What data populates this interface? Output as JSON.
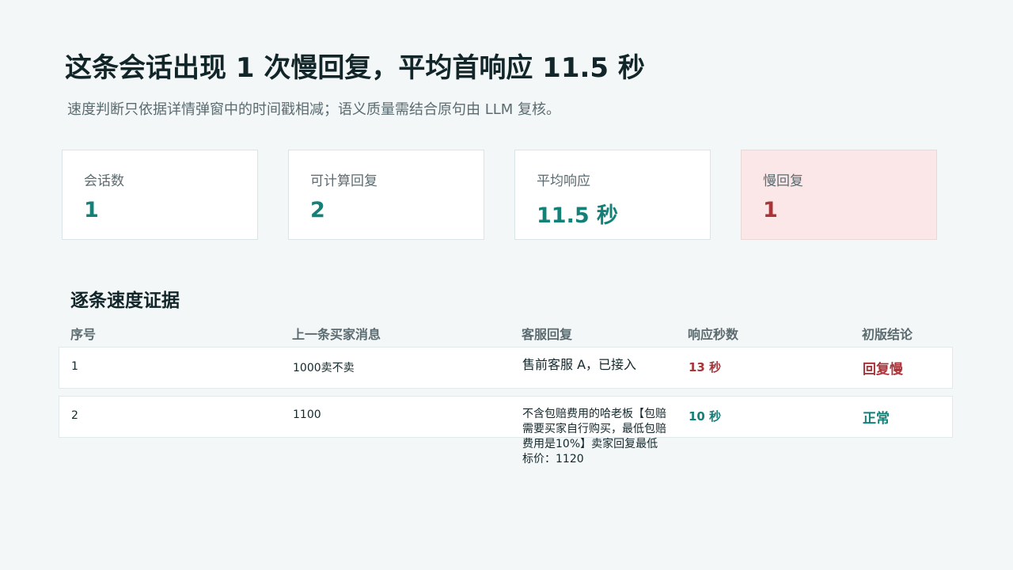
{
  "header": {
    "title": "这条会话出现 1 次慢回复，平均首响应 11.5 秒",
    "subtitle": "速度判断只依据详情弹窗中的时间戳相减；语义质量需结合原句由 LLM 复核。"
  },
  "metrics": [
    {
      "label": "会话数",
      "value": "1",
      "status": "normal"
    },
    {
      "label": "可计算回复",
      "value": "2",
      "status": "normal"
    },
    {
      "label": "平均响应",
      "value": "11.5 秒",
      "status": "normal"
    },
    {
      "label": "慢回复",
      "value": "1",
      "status": "alert"
    }
  ],
  "evidence": {
    "title": "逐条速度证据",
    "columns": [
      "序号",
      "上一条买家消息",
      "客服回复",
      "响应秒数",
      "初版结论"
    ],
    "rows": [
      {
        "index": "1",
        "buyer_message": "1000卖不卖",
        "agent_reply": "售前客服 A，已接入",
        "seconds": "13 秒",
        "verdict": "回复慢",
        "status": "slow"
      },
      {
        "index": "2",
        "buyer_message": "1100",
        "agent_reply": "不含包赔费用的哈老板【包赔需要买家自行购买，最低包赔费用是10%】卖家回复最低标价：1120",
        "seconds": "10 秒",
        "verdict": "正常",
        "status": "ok"
      }
    ]
  },
  "colors": {
    "background": "#f3f7f8",
    "accent_ok": "#138178",
    "accent_slow": "#a7353a",
    "alert_card_bg": "#fbe7e7"
  }
}
